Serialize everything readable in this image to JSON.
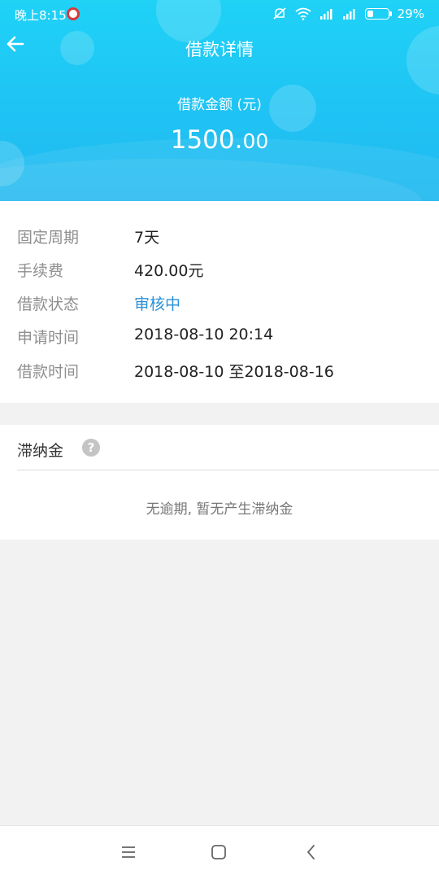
{
  "status_bar": {
    "time": "晚上8:15",
    "battery_percent": "29%",
    "battery_level": 0.29
  },
  "header": {
    "title": "借款详情",
    "amount_label": "借款金额 (元)",
    "amount_integer": "1500.",
    "amount_decimal": "00"
  },
  "details": [
    {
      "label": "固定周期",
      "value": "7天"
    },
    {
      "label": "手续费",
      "value": "420.00元"
    },
    {
      "label": "借款状态",
      "value": "审核中"
    },
    {
      "label": "申请时间",
      "value": "2018-08-10 20:14"
    },
    {
      "label": "借款时间",
      "value": "2018-08-10 至2018-08-16"
    }
  ],
  "late_fee": {
    "title": "滞纳金",
    "help_glyph": "?",
    "empty_text": "无逾期, 暂无产生滞纳金"
  },
  "colors": {
    "header_start": "#1fd2f6",
    "header_end": "#22b9ef",
    "status_accent": "#2c8fd6"
  },
  "icons": {
    "back": "arrow-left-icon",
    "help": "question-circle-icon",
    "nav_menu": "menu-icon",
    "nav_home": "square-home-icon",
    "nav_back": "chevron-left-icon"
  }
}
